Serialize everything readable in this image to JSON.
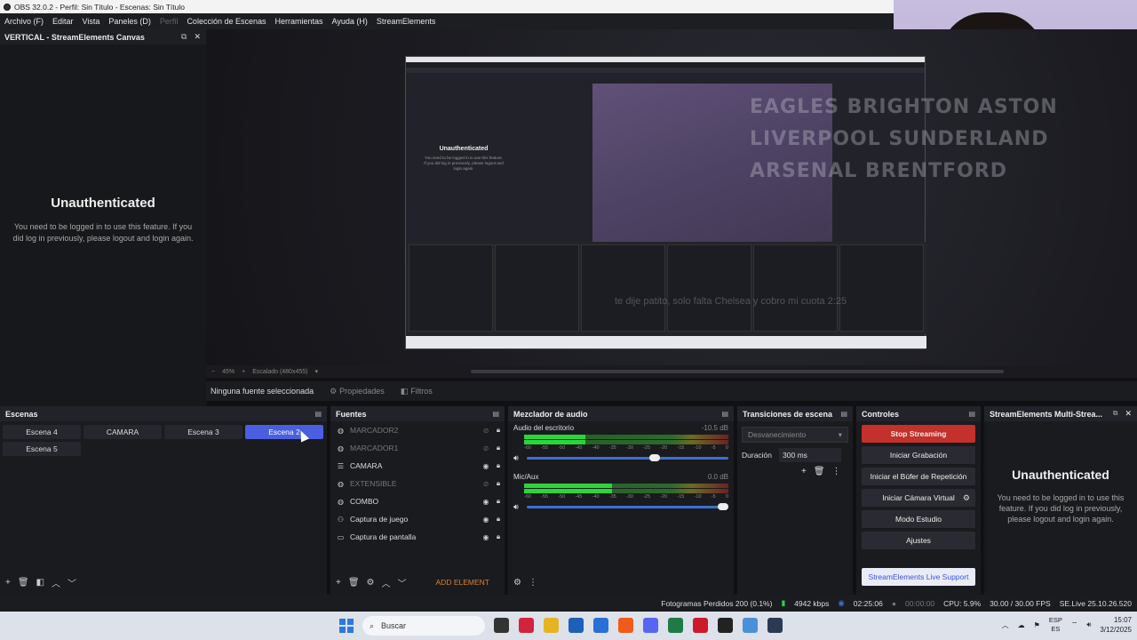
{
  "window": {
    "title": "OBS 32.0.2 - Perfil: Sin Título - Escenas: Sin Título"
  },
  "menu": [
    "Archivo (F)",
    "Editar",
    "Vista",
    "Paneles (D)",
    "Perfil",
    "Colección de Escenas",
    "Herramientas",
    "Ayuda (H)",
    "StreamElements"
  ],
  "vertical_panel": {
    "title": "VERTICAL - StreamElements Canvas",
    "unauth_title": "Unauthenticated",
    "unauth_text": "You need to be logged in to use this feature. If you did log in previously, please logout and login again."
  },
  "preview": {
    "nested_unauth": "Unauthenticated",
    "score_lines": [
      "EAGLES BRIGHTON ASTON",
      "LIVERPOOL SUNDERLAND",
      "ARSENAL BRENTFORD"
    ],
    "overlay_text": "te dije patito, solo falta Chelsea y cobro mi cuota 2:25",
    "zoom": "45%",
    "scale_label": "Escalado (480x455)"
  },
  "context_bar": {
    "no_source": "Ninguna fuente seleccionada",
    "properties": "Propiedades",
    "filters": "Filtros"
  },
  "scenes": {
    "title": "Escenas",
    "items": [
      {
        "label": "Escena 4",
        "active": false
      },
      {
        "label": "CAMARA",
        "active": false
      },
      {
        "label": "Escena 3",
        "active": false
      },
      {
        "label": "Escena 2",
        "active": true
      },
      {
        "label": "Escena 5",
        "active": false
      }
    ]
  },
  "sources": {
    "title": "Fuentes",
    "items": [
      {
        "label": "MARCADOR2",
        "icon": "globe-icon",
        "visible": false
      },
      {
        "label": "MARCADOR1",
        "icon": "globe-icon",
        "visible": false
      },
      {
        "label": "CAMARA",
        "icon": "list-icon",
        "visible": true
      },
      {
        "label": "EXTENSIBLE",
        "icon": "globe-icon",
        "visible": false
      },
      {
        "label": "COMBO",
        "icon": "globe-icon",
        "visible": true
      },
      {
        "label": "Captura de juego",
        "icon": "gamepad-icon",
        "visible": true
      },
      {
        "label": "Captura de pantalla",
        "icon": "monitor-icon",
        "visible": true
      }
    ],
    "add_element": "ADD ELEMENT"
  },
  "mixer": {
    "title": "Mezclador de audio",
    "channels": [
      {
        "name": "Audio del escritorio",
        "db": "-10.5 dB",
        "level": 0.3,
        "volume": 0.66
      },
      {
        "name": "Mic/Aux",
        "db": "0.0 dB",
        "level": 0.43,
        "volume": 1.0
      }
    ],
    "ticks": [
      "-60",
      "-55",
      "-50",
      "-45",
      "-40",
      "-35",
      "-30",
      "-25",
      "-20",
      "-15",
      "-10",
      "-5",
      "0"
    ]
  },
  "transitions": {
    "title": "Transiciones de escena",
    "selected": "Desvanecimiento",
    "duration_label": "Duración",
    "duration_value": "300 ms"
  },
  "controls": {
    "title": "Controles",
    "stop_streaming": "Stop Streaming",
    "start_recording": "Iniciar Grabación",
    "replay_buffer": "Iniciar el Búfer de Repetición",
    "virtual_camera": "Iniciar Cámara Virtual",
    "studio_mode": "Modo Estudio",
    "settings": "Ajustes",
    "se_support": "StreamElements Live Support"
  },
  "se_panel": {
    "title": "StreamElements Multi-Strea...",
    "unauth_title": "Unauthenticated",
    "unauth_text": "You need to be logged in to use this feature. If you did log in previously, please logout and login again."
  },
  "status": {
    "dropped": "Fotogramas Perdidos 200 (0.1%)",
    "bitrate": "4942 kbps",
    "stream_time": "02:25:06",
    "rec_time": "00:00:00",
    "cpu": "CPU: 5.9%",
    "fps": "30.00 / 30.00 FPS",
    "version": "SE.Live 25.10.26.520"
  },
  "taskbar": {
    "search": "Buscar",
    "lang_top": "ESP",
    "lang_bottom": "ES",
    "time": "15:07",
    "date": "3/12/2025"
  },
  "colors": {
    "accent": "#4a5ee0",
    "stream": "#c4302b",
    "meter": "#2ad63a"
  }
}
